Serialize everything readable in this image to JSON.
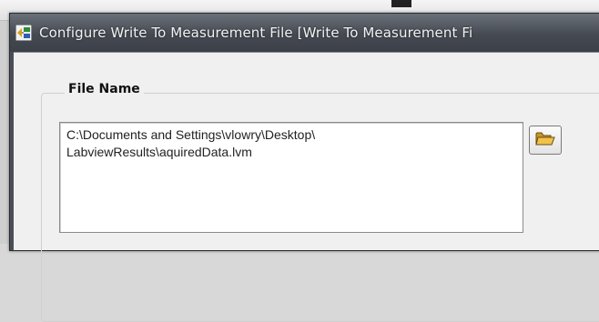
{
  "window": {
    "title": "Configure Write To Measurement File [Write To Measurement Fi"
  },
  "file_name_group": {
    "label": "File Name",
    "path_value": "C:\\Documents and Settings\\vlowry\\Desktop\\\nLabviewResults\\aquiredData.lvm"
  },
  "icons": {
    "title_icon": "labview-express-vi-icon",
    "browse_icon": "open-folder-icon"
  },
  "colors": {
    "titlebar": "#4a4f57",
    "title_text": "#f2f2f2",
    "client_background": "#f0f0f0",
    "folder": "#e8b83a"
  }
}
